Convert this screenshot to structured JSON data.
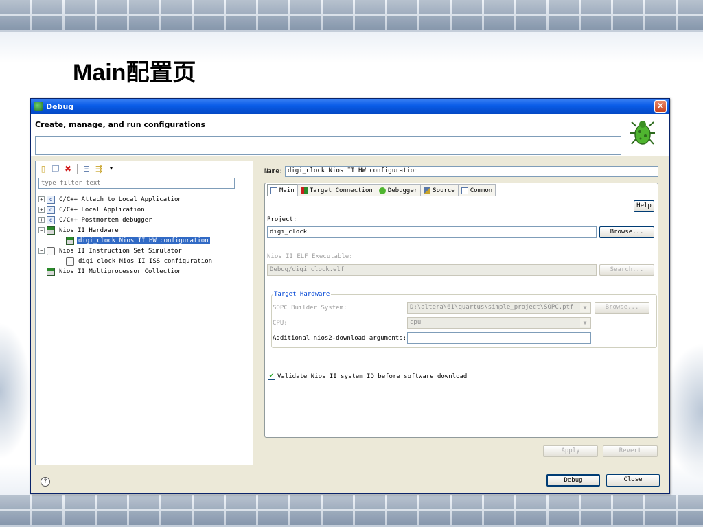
{
  "slide": {
    "title": "Main配置页"
  },
  "window": {
    "title": "Debug",
    "close_glyph": "×",
    "header_title": "Create, manage, and run configurations"
  },
  "left_panel": {
    "filter_placeholder": "type filter text",
    "tree": [
      {
        "label": "C/C++ Attach to Local Application",
        "expander": "+",
        "icon": "c-config-icon"
      },
      {
        "label": "C/C++ Local Application",
        "expander": "+",
        "icon": "c-config-icon"
      },
      {
        "label": "C/C++ Postmortem debugger",
        "expander": "+",
        "icon": "c-config-icon"
      },
      {
        "label": "Nios II Hardware",
        "expander": "−",
        "icon": "nios-hardware-icon"
      },
      {
        "label": "digi_clock Nios II HW configuration",
        "expander": "",
        "icon": "nios-hardware-icon",
        "selected": true
      },
      {
        "label": "Nios II Instruction Set Simulator",
        "expander": "−",
        "icon": "iss-icon"
      },
      {
        "label": "digi_clock Nios II ISS configuration",
        "expander": "",
        "icon": "iss-icon"
      },
      {
        "label": "Nios II Multiprocessor Collection",
        "expander": "",
        "icon": "multiprocessor-icon"
      }
    ]
  },
  "right_panel": {
    "name_label": "Name:",
    "name_value": "digi_clock Nios II HW configuration",
    "tabs": [
      {
        "label": "Main",
        "active": true
      },
      {
        "label": "Target Connection"
      },
      {
        "label": "Debugger"
      },
      {
        "label": "Source"
      },
      {
        "label": "Common"
      }
    ],
    "help_label": "Help",
    "project_label": "Project:",
    "project_value": "digi_clock",
    "browse_label": "Browse...",
    "elf_label": "Nios II ELF Executable:",
    "elf_value": "Debug/digi_clock.elf",
    "search_label": "Search...",
    "target_hardware": {
      "title": "Target Hardware",
      "sopc_label": "SOPC Builder System:",
      "sopc_value": "D:\\altera\\61\\quartus\\simple_project\\SOPC.ptf",
      "browse_label": "Browse...",
      "cpu_label": "CPU:",
      "cpu_value": "cpu",
      "args_label": "Additional nios2-download arguments:",
      "args_value": ""
    },
    "validate_label": "Validate Nios II system ID before software download",
    "validate_checked": true,
    "apply_label": "Apply",
    "revert_label": "Revert"
  },
  "footer": {
    "help_glyph": "?",
    "debug_label": "Debug",
    "close_label": "Close"
  },
  "colors": {
    "titlebar": "#0a5ce8",
    "selection": "#316ac5",
    "group_title": "#0046d5"
  }
}
